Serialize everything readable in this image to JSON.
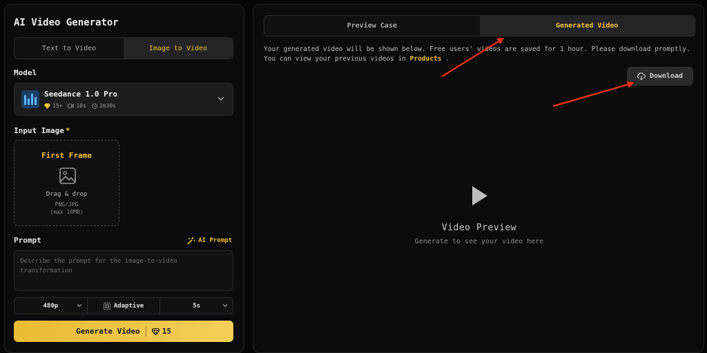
{
  "app": {
    "title": "AI Video Generator"
  },
  "mode_tabs": [
    {
      "label": "Text to Video",
      "active": false
    },
    {
      "label": "Image to Video",
      "active": true
    }
  ],
  "model": {
    "section_label": "Model",
    "name": "Seedance 1.0 Pro",
    "credits": "15+",
    "duration": "10s",
    "time": "2m30s",
    "icons": [
      "model-logo-icon",
      "gem-icon",
      "camera-icon",
      "clock-icon",
      "chevron-down-icon"
    ]
  },
  "input_image": {
    "section_label": "Input Image",
    "required_mark": "*",
    "frame_title": "First Frame",
    "drag_text": "Drag & drop",
    "formats": "PNG/JPG",
    "max_size": "(max 10MB)"
  },
  "prompt": {
    "section_label": "Prompt",
    "ai_prompt_label": "AI Prompt",
    "placeholder": "Describe the prompt for the image-to-video transformation",
    "value": ""
  },
  "options": {
    "resolution": "480p",
    "aspect": "Adaptive",
    "duration": "5s"
  },
  "generate": {
    "label": "Generate Video",
    "cost": "15"
  },
  "view_tabs": [
    {
      "label": "Preview Case",
      "active": false
    },
    {
      "label": "Generated Video",
      "active": true
    }
  ],
  "notice": {
    "line1": "Your generated video will be shown below. Free users' videos are saved for 1 hour. Please download promptly.",
    "line2_prefix": "You can view your previous videos in",
    "link": "Products",
    "line2_suffix": "."
  },
  "download": {
    "label": "Download"
  },
  "preview": {
    "title": "Video Preview",
    "subtitle": "Generate to see your video here"
  },
  "colors": {
    "accent": "#f2c33b",
    "background": "#050505",
    "panel": "#0b0b0b",
    "annotation_arrow": "#e8301c"
  }
}
